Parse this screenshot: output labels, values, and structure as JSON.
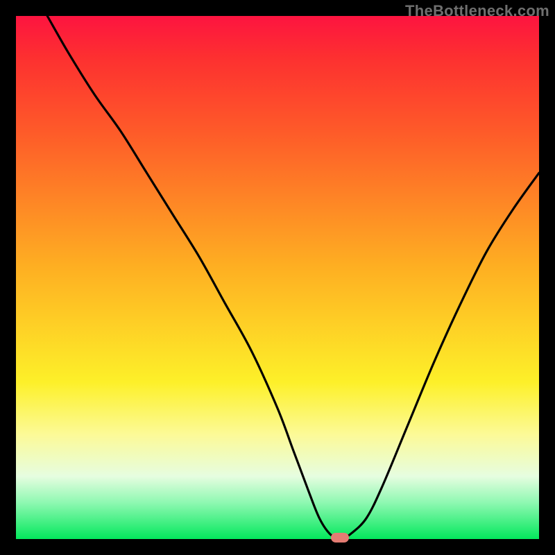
{
  "watermark": "TheBottleneck.com",
  "colors": {
    "frame": "#000000",
    "gradient_top": "#fd1440",
    "gradient_bottom": "#03e85c",
    "curve": "#000000",
    "marker": "#e47c73"
  },
  "chart_data": {
    "type": "line",
    "title": "",
    "xlabel": "",
    "ylabel": "",
    "xlim": [
      0,
      100
    ],
    "ylim": [
      0,
      100
    ],
    "grid": false,
    "series": [
      {
        "name": "bottleneck-curve",
        "x": [
          6,
          10,
          15,
          20,
          25,
          30,
          35,
          40,
          45,
          50,
          53,
          56,
          58,
          60,
          62,
          64,
          67,
          70,
          75,
          80,
          85,
          90,
          95,
          100
        ],
        "y": [
          100,
          93,
          85,
          78,
          70,
          62,
          54,
          45,
          36,
          25,
          17,
          9,
          4,
          1,
          0,
          1,
          4,
          10,
          22,
          34,
          45,
          55,
          63,
          70
        ]
      }
    ],
    "annotations": [
      {
        "name": "marker",
        "x": 62,
        "y": 0,
        "shape": "pill",
        "color": "#e47c73"
      }
    ]
  }
}
